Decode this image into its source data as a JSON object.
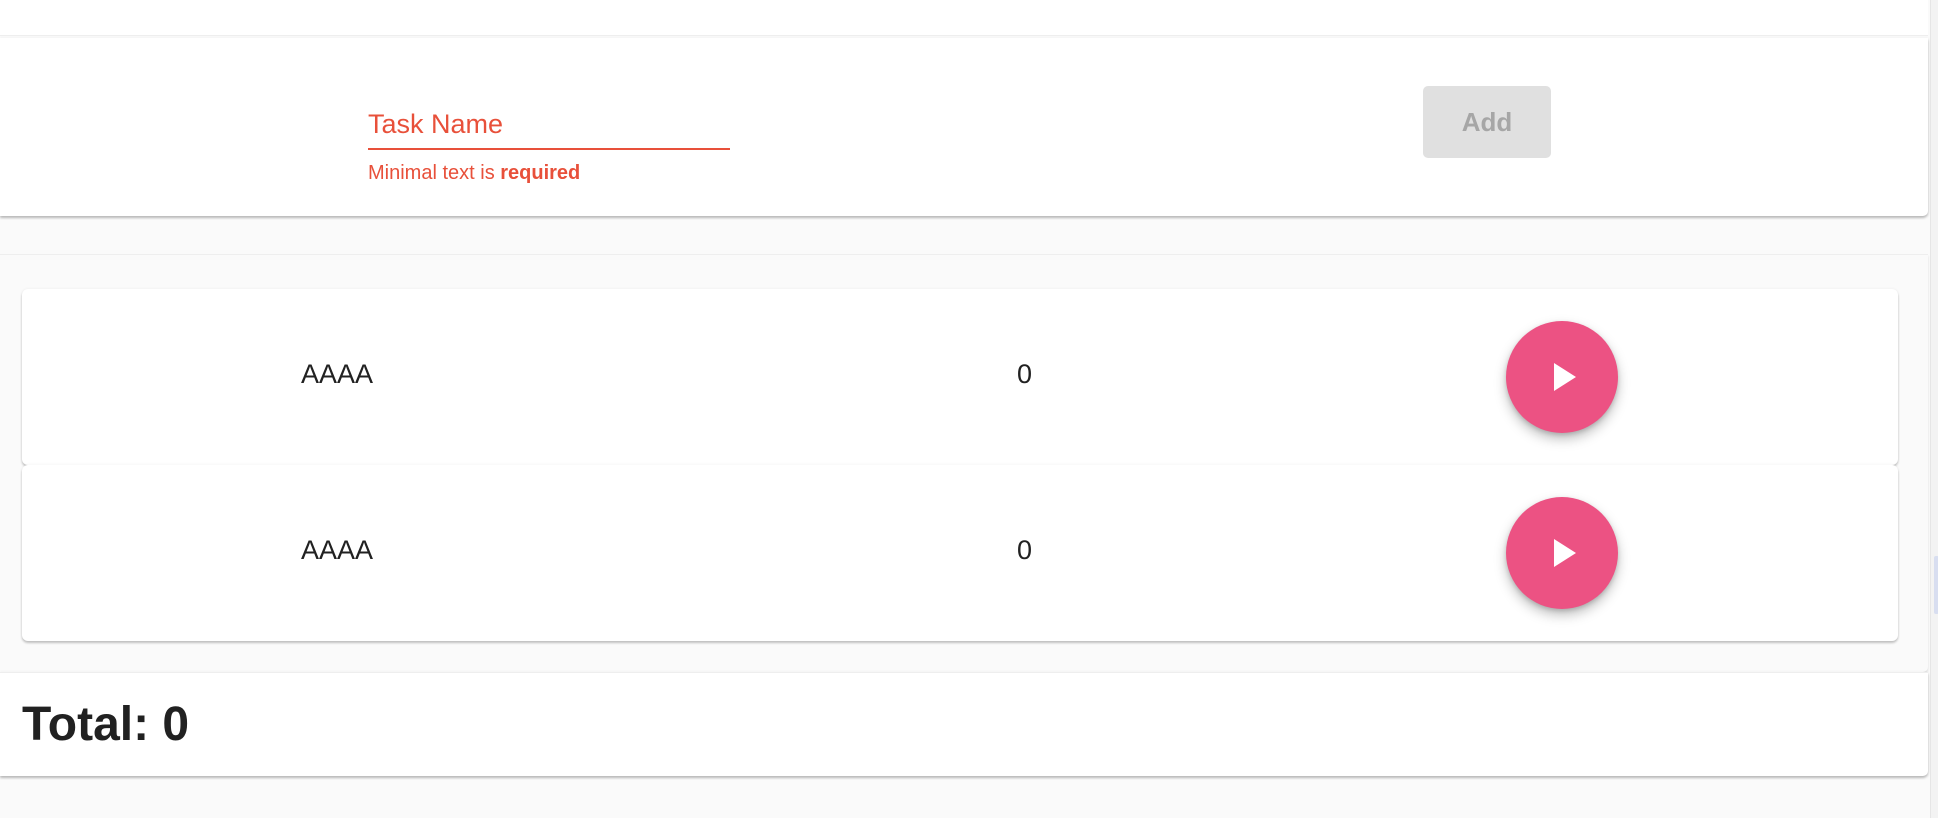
{
  "form": {
    "placeholder": "Task Name",
    "value": "",
    "error_prefix": "Minimal text is ",
    "error_emphasis": "required",
    "add_label": "Add"
  },
  "tasks": [
    {
      "name": "AAAA",
      "count": "0",
      "play_icon": "play-icon"
    },
    {
      "name": "AAAA",
      "count": "0",
      "play_icon": "play-icon"
    }
  ],
  "total": {
    "label": "Total: 0"
  },
  "colors": {
    "error": "#e8503a",
    "accent": "#ec5283",
    "disabled_bg": "#e0e0e0",
    "disabled_text": "#a6a6a6"
  }
}
